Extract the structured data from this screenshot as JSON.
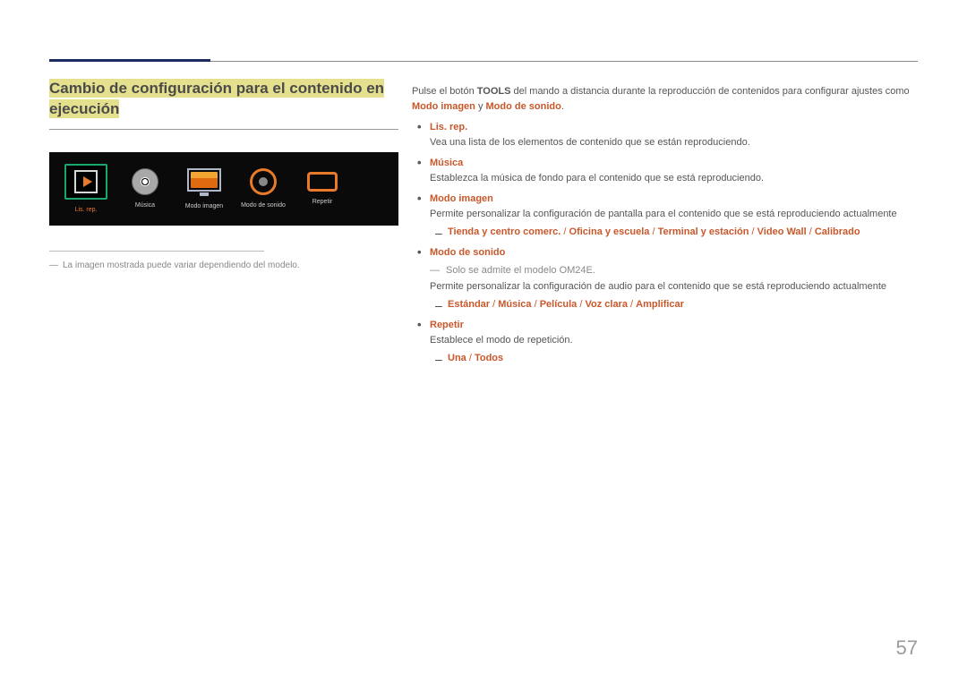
{
  "header": {
    "section_title": "Cambio de configuración para el contenido en ejecución"
  },
  "device_bar": {
    "items": [
      {
        "label": "Lis. rep.",
        "selected": true
      },
      {
        "label": "Música",
        "selected": false
      },
      {
        "label": "Modo imagen",
        "selected": false
      },
      {
        "label": "Modo de sonido",
        "selected": false
      },
      {
        "label": "Repetir",
        "selected": false
      }
    ]
  },
  "left_footnote": "La imagen mostrada puede variar dependiendo del modelo.",
  "intro": {
    "pre": "Pulse el botón ",
    "tools": "TOOLS",
    "mid": " del mando a distancia durante la reproducción de contenidos para configurar ajustes como ",
    "kw1": "Modo imagen",
    "y": " y ",
    "kw2": "Modo de sonido",
    "end": "."
  },
  "items": {
    "lisrep": {
      "head": "Lis. rep.",
      "desc": "Vea una lista de los elementos de contenido que se están reproduciendo."
    },
    "musica": {
      "head": "Música",
      "desc": "Establezca la música de fondo para el contenido que se está reproduciendo."
    },
    "modoimagen": {
      "head": "Modo imagen",
      "desc": "Permite personalizar la configuración de pantalla para el contenido que se está reproduciendo actualmente",
      "opts": {
        "o1": "Tienda y centro comerc.",
        "o2": "Oficina y escuela",
        "o3": "Terminal y estación",
        "o4": "Video Wall",
        "o5": "Calibrado"
      }
    },
    "modosonido": {
      "head": "Modo de sonido",
      "note": "Solo se admite el modelo OM24E.",
      "desc": "Permite personalizar la configuración de audio para el contenido que se está reproduciendo actualmente",
      "opts": {
        "o1": "Estándar",
        "o2": "Música",
        "o3": "Película",
        "o4": "Voz clara",
        "o5": "Amplificar"
      }
    },
    "repetir": {
      "head": "Repetir",
      "desc": "Establece el modo de repetición.",
      "opts": {
        "o1": "Una",
        "o2": "Todos"
      }
    }
  },
  "separator": " / ",
  "page_number": "57"
}
